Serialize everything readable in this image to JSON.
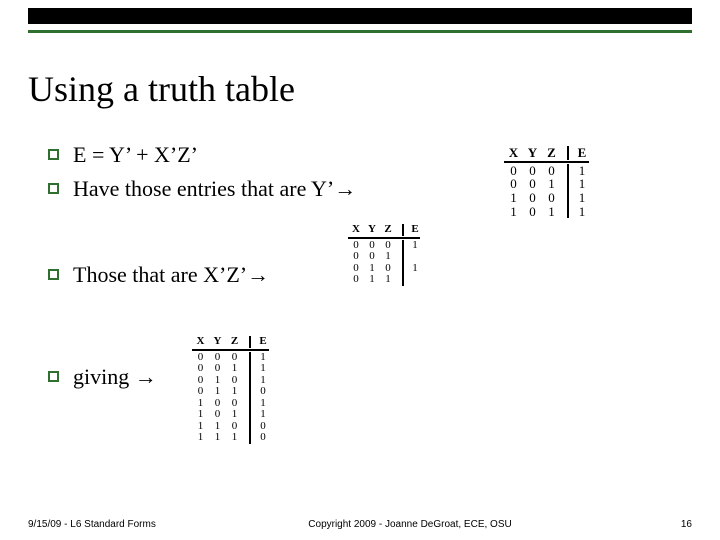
{
  "title": "Using a truth table",
  "bullets": {
    "b1": "E = Y’ + X’Z’",
    "b2": "Have those entries that are Y’→",
    "b3": "Those that are X’Z’→",
    "b4": "giving →"
  },
  "table_headers": {
    "X": "X",
    "Y": "Y",
    "Z": "Z",
    "E": "E"
  },
  "chart_data": [
    {
      "type": "table",
      "title": "Y' entries",
      "columns": [
        "X",
        "Y",
        "Z",
        "E"
      ],
      "rows": [
        {
          "X": 0,
          "Y": 0,
          "Z": 0,
          "E": 1
        },
        {
          "X": 0,
          "Y": 0,
          "Z": 1,
          "E": 1
        },
        {
          "X": 1,
          "Y": 0,
          "Z": 0,
          "E": 1
        },
        {
          "X": 1,
          "Y": 0,
          "Z": 1,
          "E": 1
        }
      ]
    },
    {
      "type": "table",
      "title": "X'Z' entries",
      "columns": [
        "X",
        "Y",
        "Z",
        "E"
      ],
      "rows": [
        {
          "X": 0,
          "Y": 0,
          "Z": 0,
          "E": 1
        },
        {
          "X": 0,
          "Y": 0,
          "Z": 1,
          "E": ""
        },
        {
          "X": 0,
          "Y": 1,
          "Z": 0,
          "E": 1
        },
        {
          "X": 0,
          "Y": 1,
          "Z": 1,
          "E": ""
        }
      ]
    },
    {
      "type": "table",
      "title": "E = Y' + X'Z' full table",
      "columns": [
        "X",
        "Y",
        "Z",
        "E"
      ],
      "rows": [
        {
          "X": 0,
          "Y": 0,
          "Z": 0,
          "E": 1
        },
        {
          "X": 0,
          "Y": 0,
          "Z": 1,
          "E": 1
        },
        {
          "X": 0,
          "Y": 1,
          "Z": 0,
          "E": 1
        },
        {
          "X": 0,
          "Y": 1,
          "Z": 1,
          "E": 0
        },
        {
          "X": 1,
          "Y": 0,
          "Z": 0,
          "E": 1
        },
        {
          "X": 1,
          "Y": 0,
          "Z": 1,
          "E": 1
        },
        {
          "X": 1,
          "Y": 1,
          "Z": 0,
          "E": 0
        },
        {
          "X": 1,
          "Y": 1,
          "Z": 1,
          "E": 0
        }
      ]
    }
  ],
  "footer": {
    "left": "9/15/09 - L6 Standard Forms",
    "center": "Copyright 2009 - Joanne DeGroat, ECE, OSU",
    "page": "16"
  }
}
